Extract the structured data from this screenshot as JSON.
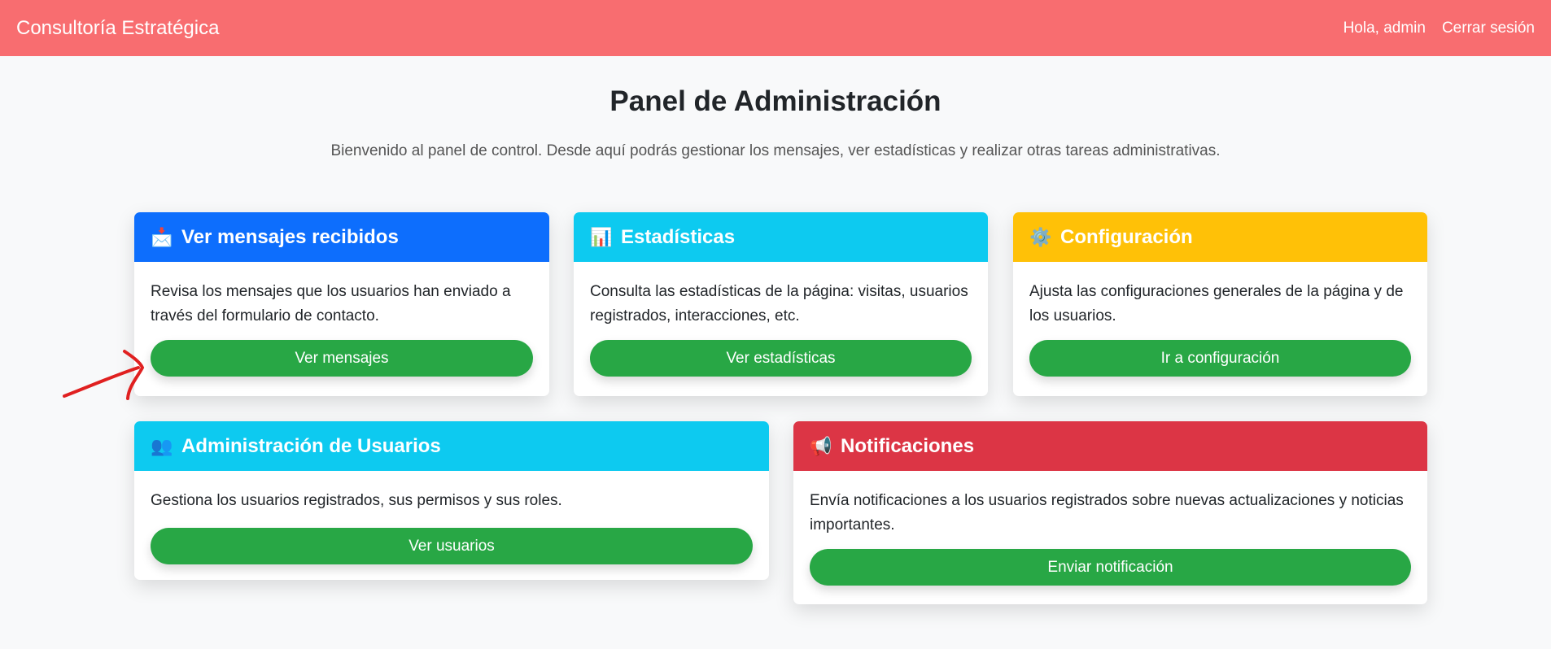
{
  "navbar": {
    "brand": "Consultoría Estratégica",
    "greeting": "Hola, admin",
    "logout": "Cerrar sesión"
  },
  "page": {
    "title": "Panel de Administración",
    "subtitle": "Bienvenido al panel de control. Desde aquí podrás gestionar los mensajes, ver estadísticas y realizar otras tareas administrativas."
  },
  "cards": [
    {
      "icon": "incoming-envelope-icon",
      "title": "Ver mensajes recibidos",
      "text": "Revisa los mensajes que los usuarios han enviado a través del formulario de contacto.",
      "button": "Ver mensajes",
      "color": "#0d6efd"
    },
    {
      "icon": "bar-chart-icon",
      "title": "Estadísticas",
      "text": "Consulta las estadísticas de la página: visitas, usuarios registrados, interacciones, etc.",
      "button": "Ver estadísticas",
      "color": "#0dcaf0"
    },
    {
      "icon": "gear-icon",
      "title": "Configuración",
      "text": "Ajusta las configuraciones generales de la página y de los usuarios.",
      "button": "Ir a configuración",
      "color": "#ffc107"
    },
    {
      "icon": "users-icon",
      "title": "Administración de Usuarios",
      "text": "Gestiona los usuarios registrados, sus permisos y sus roles.",
      "button": "Ver usuarios",
      "color": "#0dcaf0"
    },
    {
      "icon": "megaphone-icon",
      "title": "Notificaciones",
      "text": "Envía notificaciones a los usuarios registrados sobre nuevas actualizaciones y noticias importantes.",
      "button": "Enviar notificación",
      "color": "#dc3545"
    }
  ],
  "colors": {
    "navbar": "#f86d70",
    "button": "#28a745",
    "annotation": "#e02020"
  }
}
